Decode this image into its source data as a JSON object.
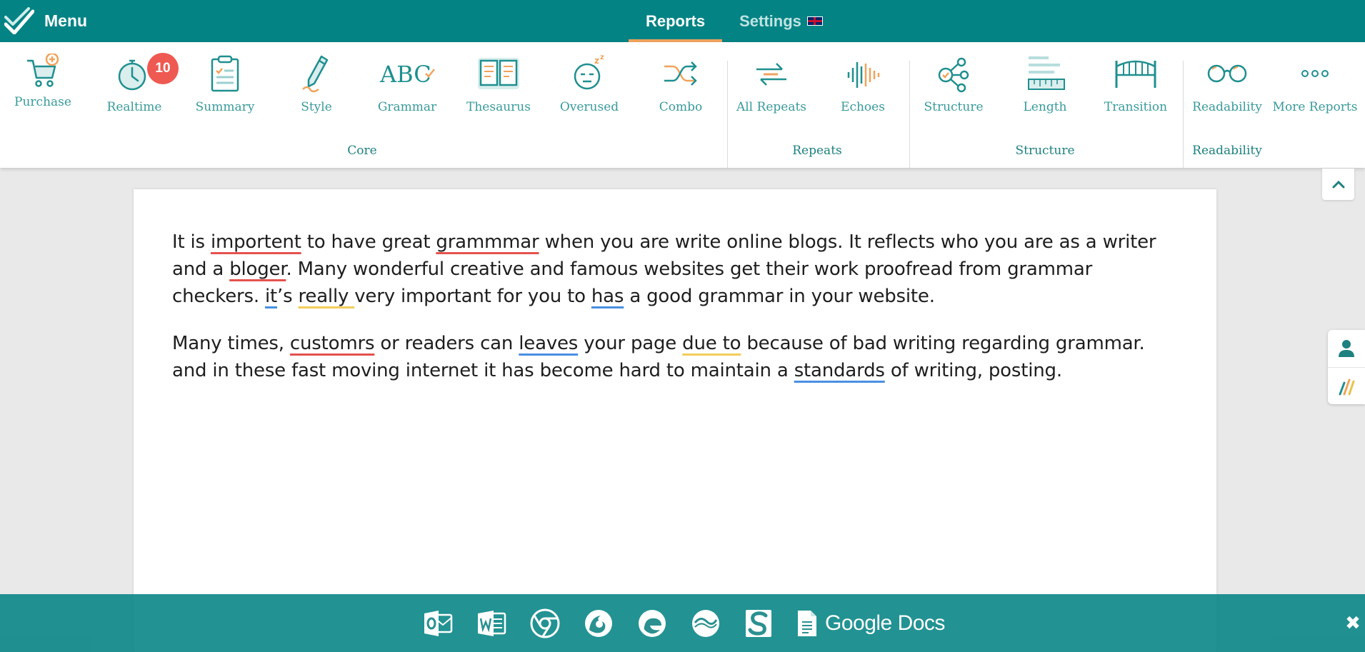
{
  "topbar": {
    "menu_label": "Menu",
    "tabs": [
      {
        "label": "Reports",
        "active": true
      },
      {
        "label": "Settings",
        "active": false
      }
    ],
    "accent_color": "#048384",
    "active_tab_underline_color": "#f0a35c"
  },
  "toolbar": {
    "tools": [
      {
        "label": "Purchase",
        "icon": "cart-plus-icon"
      },
      {
        "label": "Realtime",
        "icon": "stopwatch-icon",
        "badge": "10"
      },
      {
        "label": "Summary",
        "icon": "clipboard-icon"
      },
      {
        "label": "Style",
        "icon": "pencil-icon"
      },
      {
        "label": "Grammar",
        "icon": "abc-check-icon"
      },
      {
        "label": "Thesaurus",
        "icon": "open-book-icon"
      },
      {
        "label": "Overused",
        "icon": "sleepy-face-icon"
      },
      {
        "label": "Combo",
        "icon": "shuffle-icon"
      },
      {
        "label": "All Repeats",
        "icon": "repeat-arrows-icon"
      },
      {
        "label": "Echoes",
        "icon": "sound-wave-icon"
      },
      {
        "label": "Structure",
        "icon": "node-tree-icon"
      },
      {
        "label": "Length",
        "icon": "ruler-lines-icon"
      },
      {
        "label": "Transition",
        "icon": "bridge-icon"
      },
      {
        "label": "Readability",
        "icon": "glasses-icon"
      },
      {
        "label": "More Reports",
        "icon": "dots-icon"
      }
    ],
    "groups": [
      "Core",
      "Repeats",
      "Structure",
      "Readability"
    ]
  },
  "document": {
    "p1": {
      "w1": "importent",
      "t1": " to have great ",
      "w2": "grammmar",
      "t2": " when you are write online blogs. It reflects who you are as a writer and a ",
      "w3": "bloger",
      "t3": ". Many wonderful creative and famous websites get their work proofread from grammar checkers. ",
      "w4": "it",
      "t4": "’s ",
      "w5": "really ",
      "t5": "very important for you to ",
      "w6": "has",
      "t6": " a good grammar in your website.",
      "t0": "It is "
    },
    "p2": {
      "t0": "Many times, ",
      "w1": "customrs",
      "t1": " or readers can ",
      "w2": "leaves",
      "t2": " your page ",
      "w3": "due to",
      "t3": " because of bad writing regarding grammar. and in these fast moving internet it has become hard to maintain a ",
      "w4": "standards",
      "t4": " of writing, posting."
    },
    "underline_colors": {
      "spelling": "#e4524e",
      "style": "#f3cd5a",
      "grammar": "#4a90e2"
    }
  },
  "bottombar": {
    "integrations": [
      "outlook-icon",
      "word-icon",
      "chrome-icon",
      "firefox-icon",
      "edge-icon",
      "scrivener-icon",
      "scrivener-s-icon",
      "google-docs-icon"
    ],
    "google_docs_label": "Google Docs",
    "close_label": "✖"
  }
}
